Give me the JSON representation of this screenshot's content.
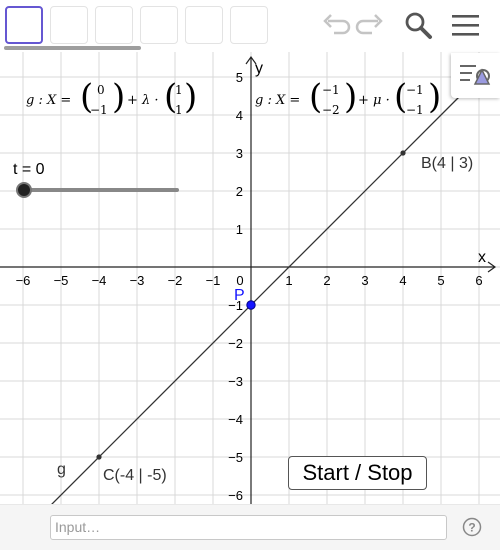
{
  "toolbar": {
    "tool_count": 6,
    "selected_tool_index": 0,
    "icons": [
      "undo-icon",
      "redo-icon",
      "search-icon",
      "menu-icon"
    ]
  },
  "graph": {
    "axis_x_label": "x",
    "axis_y_label": "y",
    "x_ticks": [
      "−6",
      "−5",
      "−4",
      "−3",
      "−2",
      "−1",
      "0",
      "1",
      "2",
      "3",
      "4",
      "5",
      "6"
    ],
    "y_ticks": [
      "5",
      "4",
      "3",
      "2",
      "1",
      "−1",
      "−2",
      "−3",
      "−4",
      "−5",
      "−6"
    ],
    "equation_g": "g : X = (0 ; −1) + λ · (1 ; 1)",
    "equation_g_alt": "g : X = (−1 ; −2) + μ · (−1 ; −1)",
    "line_label": "g",
    "point_P_label": "P",
    "point_B_label": "B(4 | 3)",
    "point_C_label": "C(-4 | -5)",
    "slider_label": "t = 0",
    "slider_value": 0,
    "point_color": "#1414ff",
    "line_color": "#333333"
  },
  "start_stop_label": "Start / Stop",
  "input": {
    "placeholder": "Input…"
  }
}
